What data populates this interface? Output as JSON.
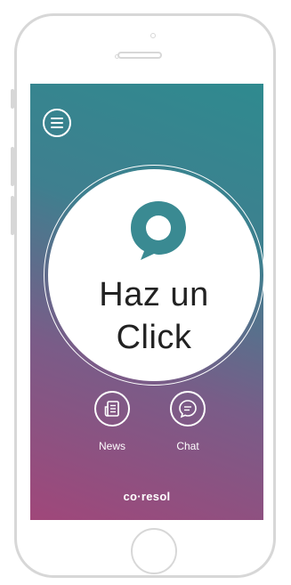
{
  "screen": {
    "menu_icon": "hamburger-menu-icon",
    "cta": {
      "icon": "chat-bubble-icon",
      "line1": "Haz un",
      "line2": "Click"
    },
    "actions": [
      {
        "label": "News",
        "icon": "news-icon"
      },
      {
        "label": "Chat",
        "icon": "chat-icon"
      }
    ],
    "brand": "co·resol"
  },
  "colors": {
    "gradient_top": "#2f8a8f",
    "gradient_bottom": "#a0477a",
    "bubble": "#3a8a92",
    "frame": "#d7d7d7"
  }
}
